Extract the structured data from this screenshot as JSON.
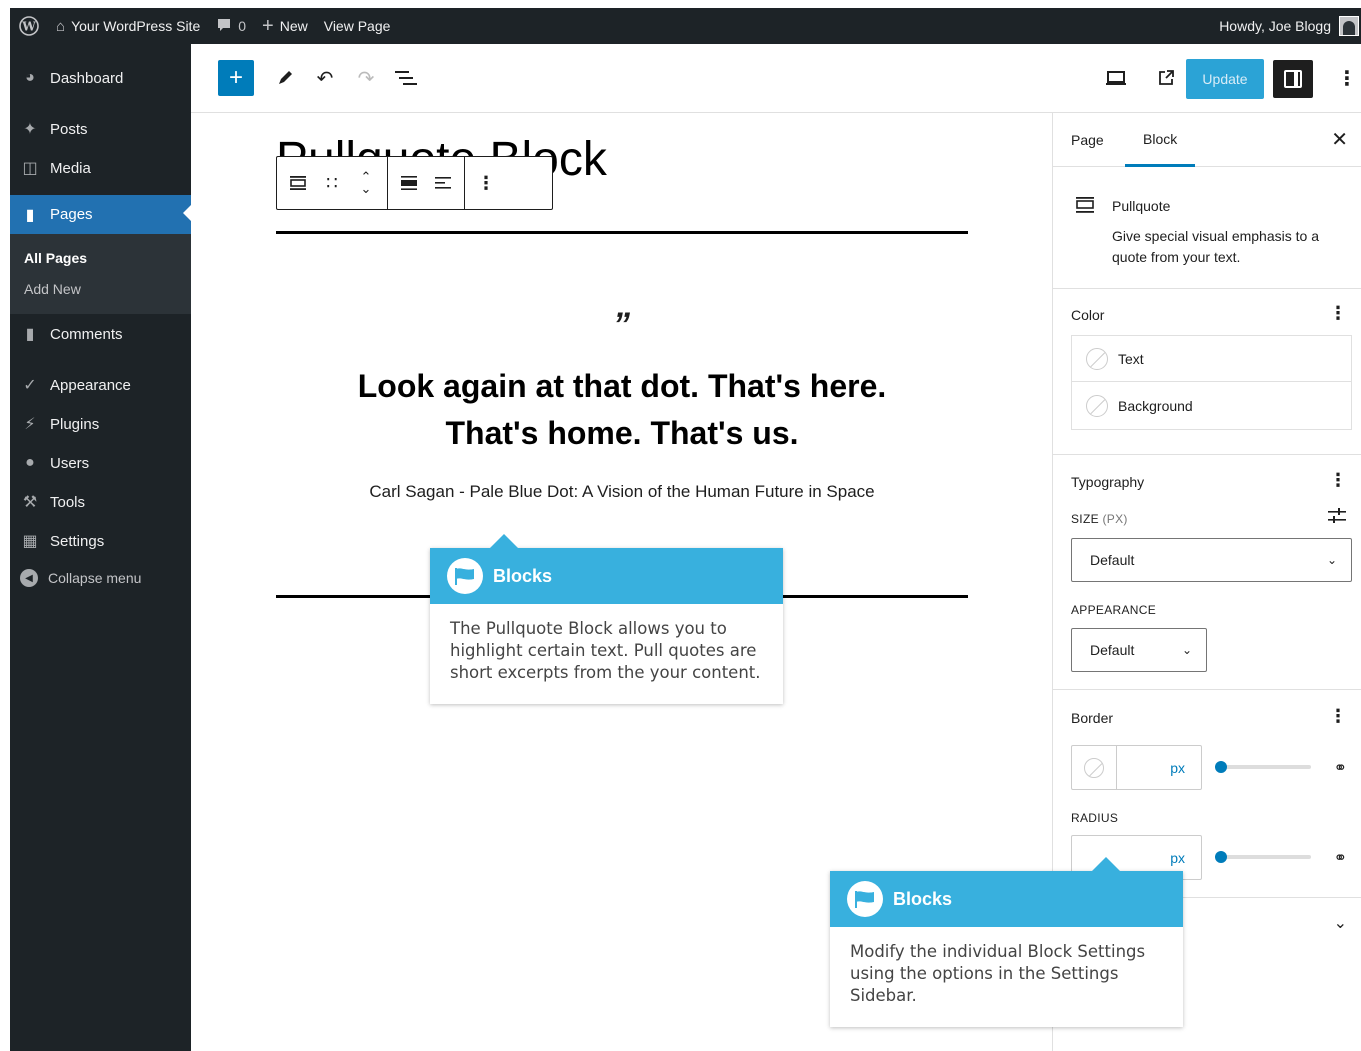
{
  "admin_bar": {
    "site_name": "Your WordPress Site",
    "comments_count": "0",
    "new_label": "New",
    "view_page": "View Page",
    "greeting": "Howdy, Joe Blogg"
  },
  "sidebar": {
    "items": [
      {
        "label": "Dashboard",
        "icon": "dashboard-icon"
      },
      {
        "label": "Posts",
        "icon": "pin-icon"
      },
      {
        "label": "Media",
        "icon": "media-icon"
      },
      {
        "label": "Pages",
        "icon": "pages-icon"
      },
      {
        "label": "Comments",
        "icon": "comments-icon"
      },
      {
        "label": "Appearance",
        "icon": "appearance-icon"
      },
      {
        "label": "Plugins",
        "icon": "plugins-icon"
      },
      {
        "label": "Users",
        "icon": "users-icon"
      },
      {
        "label": "Tools",
        "icon": "tools-icon"
      },
      {
        "label": "Settings",
        "icon": "settings-icon"
      }
    ],
    "submenu": [
      "All Pages",
      "Add New"
    ],
    "collapse_label": "Collapse menu"
  },
  "toolbar": {
    "update_label": "Update"
  },
  "canvas": {
    "title": "Pullquote Block",
    "quote_mark": "”",
    "quote_line1": "Look again at that dot. That's here.",
    "quote_line2": "That's home. That's us.",
    "citation": "Carl Sagan - Pale Blue Dot: A Vision of the Human Future in Space"
  },
  "settings": {
    "tabs": [
      "Page",
      "Block"
    ],
    "block_name": "Pullquote",
    "block_desc": "Give special visual emphasis to a quote from your text.",
    "color_title": "Color",
    "color_text": "Text",
    "color_background": "Background",
    "typography_title": "Typography",
    "size_label": "SIZE",
    "size_unit": "(PX)",
    "size_value": "Default",
    "appearance_label": "APPEARANCE",
    "appearance_value": "Default",
    "border_title": "Border",
    "px": "px",
    "radius_label": "RADIUS"
  },
  "tooltips": [
    {
      "title": "Blocks",
      "body": "The Pullquote Block allows you to highlight certain text. Pull quotes are short excerpts from the your content."
    },
    {
      "title": "Blocks",
      "body": "Modify the individual Block Settings using the options in the Settings Sidebar."
    }
  ],
  "colors": {
    "admin_dark": "#1d2327",
    "wp_blue": "#2271b1",
    "accent": "#007cba",
    "tooltip_blue": "#38b0de"
  }
}
